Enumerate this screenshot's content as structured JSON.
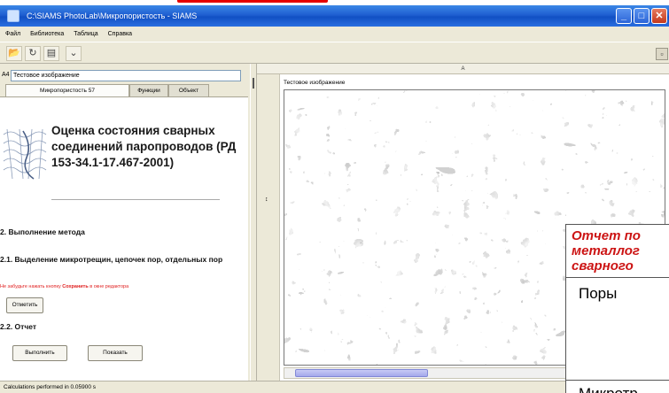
{
  "window": {
    "title": "C:\\SIAMS PhotoLab\\Микропористость - SIAMS",
    "buttons": {
      "minimize": "_",
      "maximize": "□",
      "close": "✕"
    }
  },
  "menu": [
    "Файл",
    "Библиотека",
    "Таблица",
    "Справка"
  ],
  "toolbar": {
    "icons": [
      "open-folder-icon",
      "refresh-icon",
      "library-icon",
      "minimize-panel-icon"
    ],
    "glyphs": [
      "📂",
      "↻",
      "▤",
      "⌄"
    ],
    "right_glyph": "▫"
  },
  "left": {
    "field_label": "А4",
    "field_value": "Тестовое изображение",
    "tabs": [
      "Микропористость 57",
      "Функции",
      "Объект"
    ],
    "heading": "Оценка состояния сварных соединений паропроводов (РД 153-34.1-17.467-2001)",
    "section_2": "2. Выполнение метода",
    "section_21": "2.1. Выделение микротрещин, цепочек пор, отдельных пор",
    "note_prefix": "Не забудьте нажать кнопку",
    "note_save": "Сохранить",
    "note_suffix": "в окне редактора",
    "btn_mark": "Отметить",
    "section_22": "2.2. Отчет",
    "btn_run": "Выполнить",
    "btn_show": "Показать"
  },
  "right": {
    "header": "А",
    "gutter_mark": "↕",
    "image_label": "Тестовое изображение"
  },
  "status": "Calculations performed in 0.05900 s",
  "report": {
    "title_lines": [
      "Отчет по",
      "металлог",
      "сварного"
    ],
    "row_pores": "Поры",
    "row_micro": "Микротр"
  }
}
